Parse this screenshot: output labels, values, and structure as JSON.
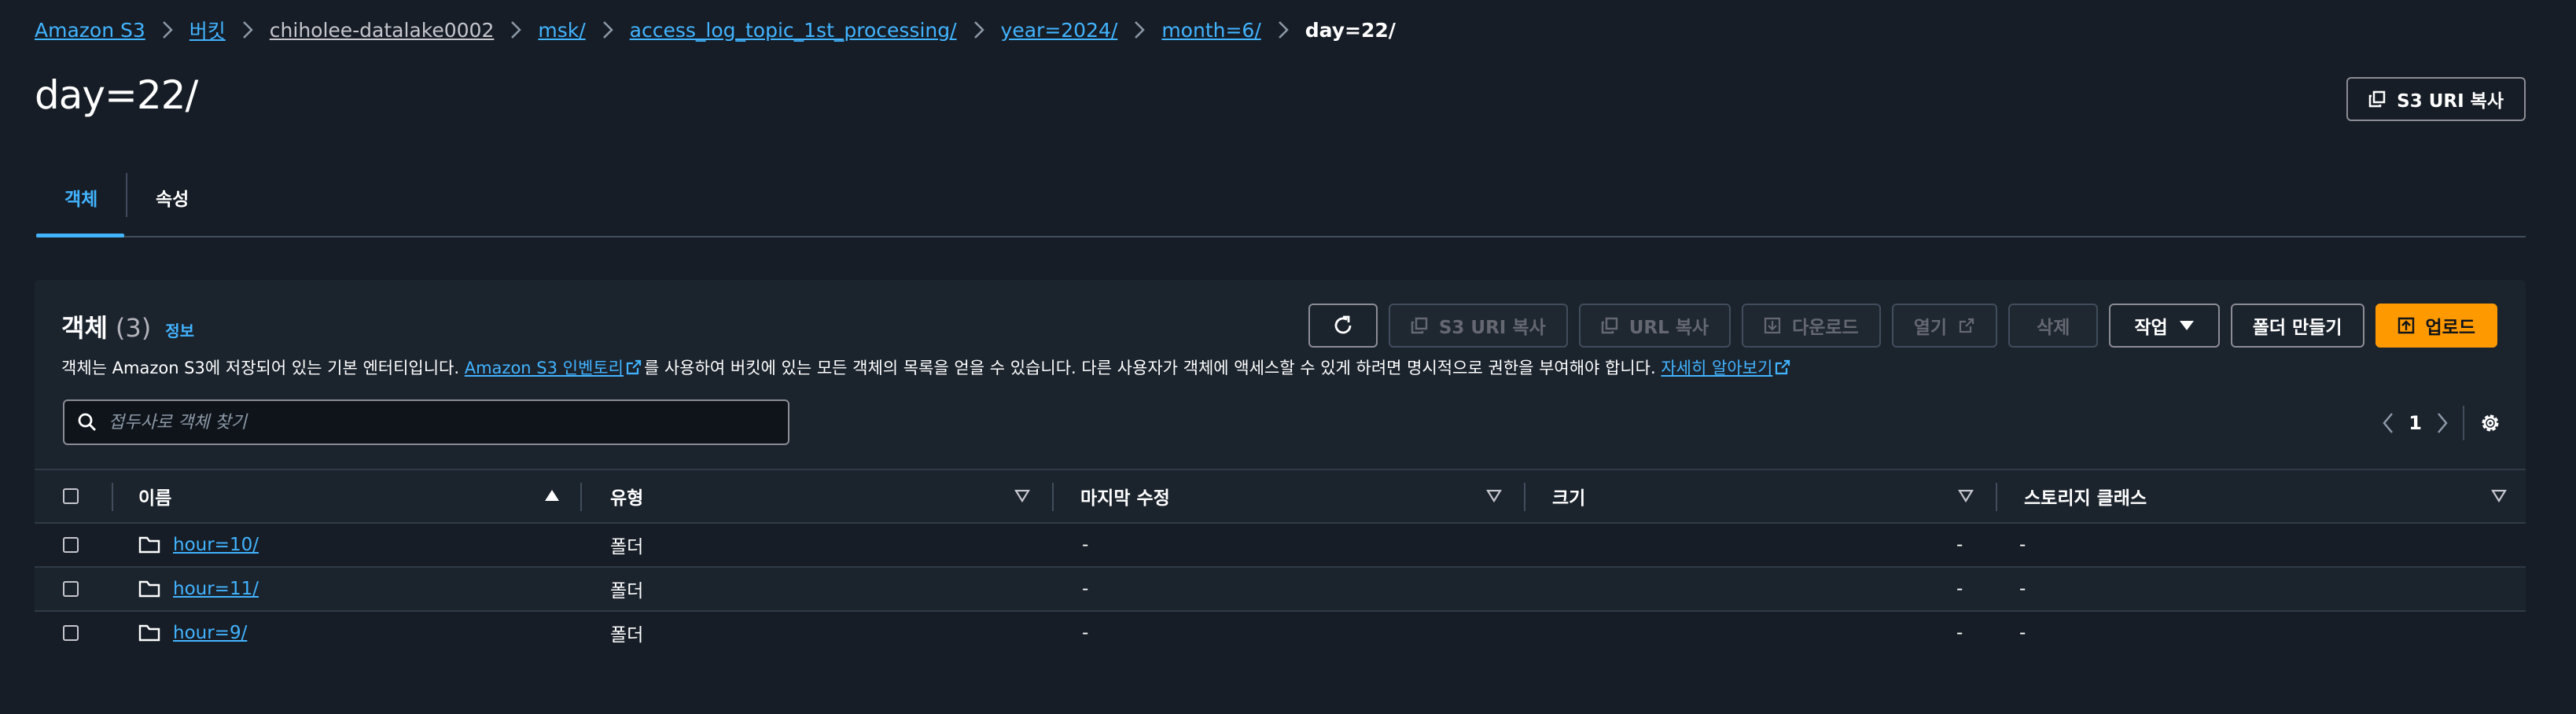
{
  "breadcrumb": [
    {
      "label": "Amazon S3",
      "style": "link"
    },
    {
      "label": "버킷",
      "style": "link"
    },
    {
      "label": "chiholee-datalake0002",
      "style": "gray"
    },
    {
      "label": "msk/",
      "style": "link"
    },
    {
      "label": "access_log_topic_1st_processing/",
      "style": "link"
    },
    {
      "label": "year=2024/",
      "style": "link"
    },
    {
      "label": "month=6/",
      "style": "link"
    },
    {
      "label": "day=22/",
      "style": "current"
    }
  ],
  "page": {
    "title": "day=22/",
    "copy_uri_label": "S3 URI 복사"
  },
  "tabs": [
    {
      "label": "객체",
      "active": true
    },
    {
      "label": "속성",
      "active": false
    }
  ],
  "objects_panel": {
    "title": "객체",
    "count": "(3)",
    "info_label": "정보",
    "description": {
      "part1": "객체는 Amazon S3에 저장되어 있는 기본 엔터티입니다. ",
      "link1": "Amazon S3 인벤토리",
      "part2": "를 사용하여 버킷에 있는 모든 객체의 목록을 얻을 수 있습니다. 다른 사용자가 객체에 액세스할 수 있게 하려면 명시적으로 권한을 부여해야 합니다. ",
      "link2": "자세히 알아보기"
    },
    "toolbar": {
      "copy_s3_uri": "S3 URI 복사",
      "copy_url": "URL 복사",
      "download": "다운로드",
      "open": "열기",
      "delete": "삭제",
      "actions": "작업",
      "create_folder": "폴더 만들기",
      "upload": "업로드"
    },
    "search": {
      "placeholder": "접두사로 객체 찾기"
    },
    "pagination": {
      "page": "1"
    },
    "columns": [
      "이름",
      "유형",
      "마지막 수정",
      "크기",
      "스토리지 클래스"
    ],
    "rows": [
      {
        "name": "hour=10/",
        "type": "폴더",
        "modified": "-",
        "size": "-",
        "storage_class": "-"
      },
      {
        "name": "hour=11/",
        "type": "폴더",
        "modified": "-",
        "size": "-",
        "storage_class": "-"
      },
      {
        "name": "hour=9/",
        "type": "폴더",
        "modified": "-",
        "size": "-",
        "storage_class": "-"
      }
    ]
  },
  "colors": {
    "background": "#161d26",
    "link": "#42b4ff",
    "primary_button": "#ff9900"
  }
}
